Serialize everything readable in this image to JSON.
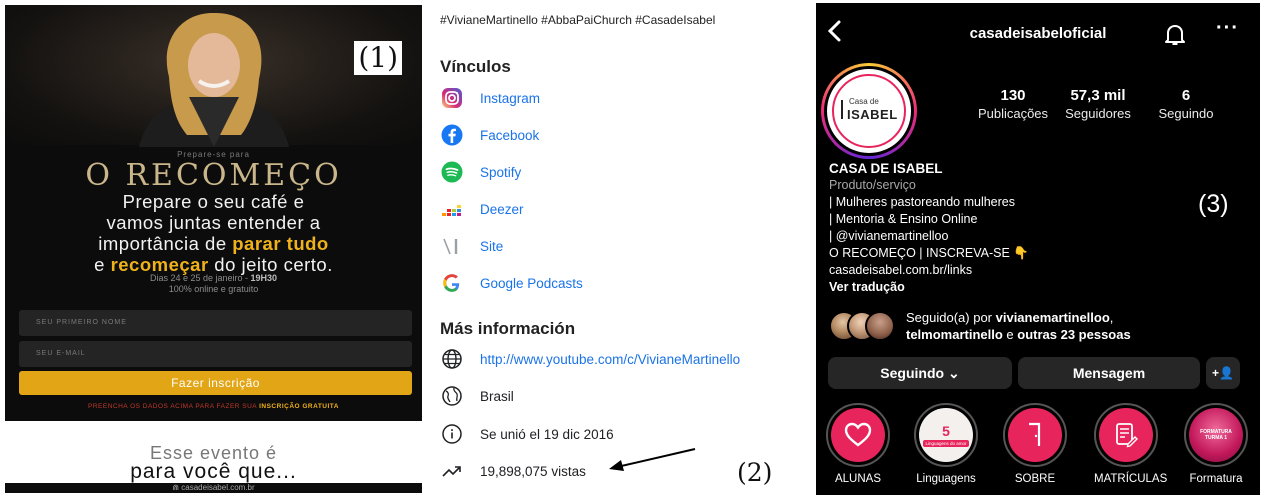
{
  "panel1": {
    "marker": "(1)",
    "pretitle": "Prepare-se para",
    "title": "O RECOMEÇO",
    "lead": {
      "line1": "Prepare o seu café e",
      "line2": "vamos juntas entender a",
      "line3_pre": "importância de ",
      "line3_hl": "parar tudo",
      "line4_hl": "recomeçar",
      "line4_pre": "e ",
      "line4_post": " do jeito certo."
    },
    "dates": {
      "line1_pre": "Dias 24 e 25 de janeiro - ",
      "line1_time": "19H30",
      "line2": "100% online e gratuito"
    },
    "form": {
      "name_placeholder": "SEU PRIMEIRO NOME",
      "email_placeholder": "SEU E-MAIL",
      "submit": "Fazer inscrição",
      "hint_pre": "PREENCHA OS DADOS ACIMA PARA FAZER SUA ",
      "hint_hl": "INSCRIÇÃO GRATUITA"
    },
    "event": {
      "line1": "Esse evento é",
      "line2": "para você que..."
    },
    "site": "casadeisabel.com.br"
  },
  "panel2": {
    "marker": "(2)",
    "hashtags": "#VivianeMartinello #AbbaPaiChurch #CasadeIsabel",
    "links_heading": "Vínculos",
    "links": [
      {
        "label": "Instagram",
        "icon": "instagram-icon"
      },
      {
        "label": "Facebook",
        "icon": "facebook-icon"
      },
      {
        "label": "Spotify",
        "icon": "spotify-icon"
      },
      {
        "label": "Deezer",
        "icon": "deezer-icon"
      },
      {
        "label": "Site",
        "icon": "site-icon"
      },
      {
        "label": "Google Podcasts",
        "icon": "google-icon"
      }
    ],
    "more_heading": "Más información",
    "info": {
      "url": "http://www.youtube.com/c/VivianeMartinello",
      "country": "Brasil",
      "joined": "Se unió el 19 dic 2016",
      "views": "19,898,075 vistas"
    },
    "colors": {
      "link": "#1a73e8",
      "instagram": "#d6249f",
      "facebook": "#1877f2",
      "spotify": "#1db954"
    }
  },
  "panel3": {
    "marker": "(3)",
    "username": "casadeisabeloficial",
    "avatar": {
      "small": "Casa de",
      "big": "ISABEL"
    },
    "stats": [
      {
        "num": "130",
        "label": "Publicações"
      },
      {
        "num": "57,3 mil",
        "label": "Seguidores"
      },
      {
        "num": "6",
        "label": "Seguindo"
      }
    ],
    "bio": {
      "name": "CASA DE ISABEL",
      "category": "Produto/serviço",
      "line1": "| Mulheres pastoreando mulheres",
      "line2": "| Mentoria & Ensino Online",
      "line3": "| @vivianemartinelloo",
      "line4": "O RECOMEÇO | INSCREVA-SE 👇",
      "link": "casadeisabel.com.br/links",
      "translate": "Ver tradução"
    },
    "followed_by": {
      "pre": "Seguido(a) por ",
      "user1": "vivianemartinelloo",
      "sep": ",",
      "user2": "telmomartinello",
      "mid": " e ",
      "rest": "outras 23 pessoas"
    },
    "buttons": {
      "following": "Seguindo ⌄",
      "message": "Mensagem",
      "add": "+👤"
    },
    "highlights": [
      {
        "label": "ALUNAS",
        "icon": "heart-icon"
      },
      {
        "label": "Linguagens",
        "badge_num": "5",
        "badge_text": "Linguagens do amor"
      },
      {
        "label": "SOBRE",
        "icon": "door-icon"
      },
      {
        "label": "MATRÍCULAS",
        "icon": "form-icon"
      },
      {
        "label": "Formatura",
        "badge_text": "FORMATURA TURMA 1"
      }
    ],
    "colors": {
      "brand": "#e8245c",
      "button": "#262626"
    }
  }
}
